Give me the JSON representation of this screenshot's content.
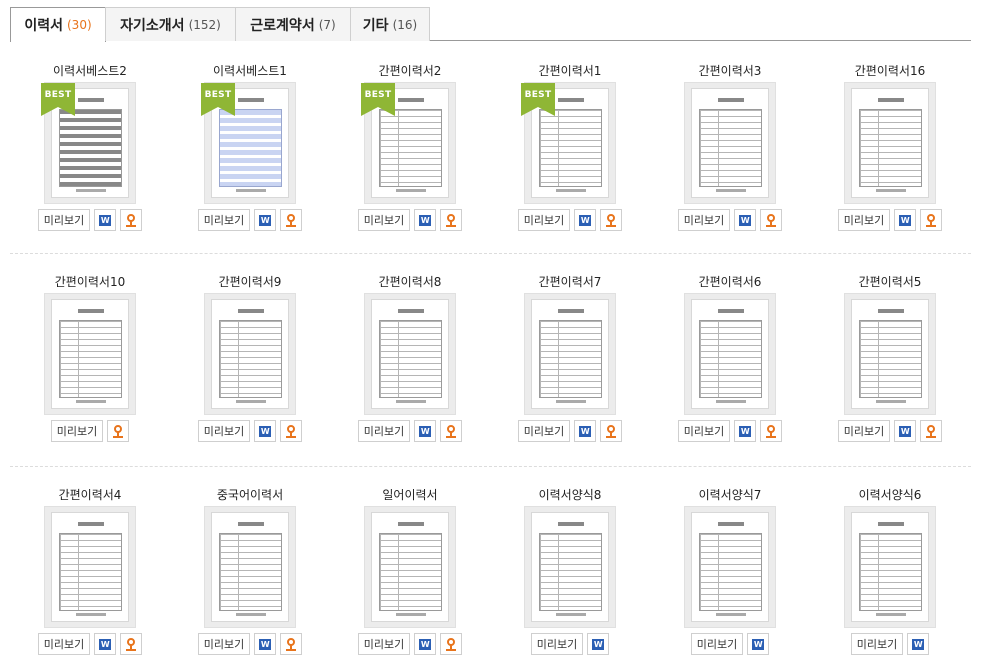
{
  "tabs": [
    {
      "label": "이력서",
      "count": "(30)",
      "active": true
    },
    {
      "label": "자기소개서",
      "count": "(152)",
      "active": false
    },
    {
      "label": "근로계약서",
      "count": "(7)",
      "active": false
    },
    {
      "label": "기타",
      "count": "(16)",
      "active": false
    }
  ],
  "preview_label": "미리보기",
  "word_icon_glyph": "W",
  "badge_label": "BEST",
  "colors": {
    "accent": "#e8741c",
    "best_badge": "#8fb635",
    "word_blue": "#2b5fb4"
  },
  "rows": [
    [
      {
        "title": "이력서베스트2",
        "best": true,
        "style": "dark",
        "icons": [
          "word-icon",
          "hwp-icon"
        ]
      },
      {
        "title": "이력서베스트1",
        "best": true,
        "style": "blue",
        "icons": [
          "word-icon",
          "hwp-icon"
        ]
      },
      {
        "title": "간편이력서2",
        "best": true,
        "style": "plain",
        "icons": [
          "word-icon",
          "hwp-icon"
        ]
      },
      {
        "title": "간편이력서1",
        "best": true,
        "style": "plain",
        "icons": [
          "word-icon",
          "hwp-icon"
        ]
      },
      {
        "title": "간편이력서3",
        "best": false,
        "style": "plain",
        "icons": [
          "word-icon",
          "hwp-icon"
        ]
      },
      {
        "title": "간편이력서16",
        "best": false,
        "style": "plain",
        "icons": [
          "word-icon",
          "hwp-icon"
        ]
      }
    ],
    [
      {
        "title": "간편이력서10",
        "best": false,
        "style": "plain",
        "icons": [
          "hwp-icon"
        ]
      },
      {
        "title": "간편이력서9",
        "best": false,
        "style": "plain",
        "icons": [
          "word-icon",
          "hwp-icon"
        ]
      },
      {
        "title": "간편이력서8",
        "best": false,
        "style": "plain",
        "icons": [
          "word-icon",
          "hwp-icon"
        ]
      },
      {
        "title": "간편이력서7",
        "best": false,
        "style": "plain",
        "icons": [
          "word-icon",
          "hwp-icon"
        ]
      },
      {
        "title": "간편이력서6",
        "best": false,
        "style": "plain",
        "icons": [
          "word-icon",
          "hwp-icon"
        ]
      },
      {
        "title": "간편이력서5",
        "best": false,
        "style": "plain",
        "icons": [
          "word-icon",
          "hwp-icon"
        ]
      }
    ],
    [
      {
        "title": "간편이력서4",
        "best": false,
        "style": "plain",
        "icons": [
          "word-icon",
          "hwp-icon"
        ]
      },
      {
        "title": "중국어이력서",
        "best": false,
        "style": "plain",
        "icons": [
          "word-icon",
          "hwp-icon"
        ]
      },
      {
        "title": "일어이력서",
        "best": false,
        "style": "plain",
        "icons": [
          "word-icon",
          "hwp-icon"
        ]
      },
      {
        "title": "이력서양식8",
        "best": false,
        "style": "plain",
        "icons": [
          "word-icon"
        ]
      },
      {
        "title": "이력서양식7",
        "best": false,
        "style": "plain",
        "icons": [
          "word-icon"
        ]
      },
      {
        "title": "이력서양식6",
        "best": false,
        "style": "plain",
        "icons": [
          "word-icon"
        ]
      }
    ]
  ]
}
